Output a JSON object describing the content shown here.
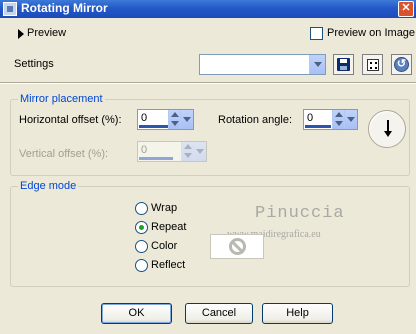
{
  "window": {
    "title": "Rotating Mirror"
  },
  "preview": {
    "label": "Preview",
    "on_image_label": "Preview on Image",
    "on_image_checked": false
  },
  "settings": {
    "label": "Settings",
    "preset_value": ""
  },
  "mirror_placement": {
    "legend": "Mirror placement",
    "horizontal_offset": {
      "label": "Horizontal offset (%):",
      "value": "0"
    },
    "vertical_offset": {
      "label": "Vertical offset (%):",
      "value": "0",
      "disabled": true
    },
    "rotation_angle": {
      "label": "Rotation angle:",
      "value": "0"
    }
  },
  "edge_mode": {
    "legend": "Edge mode",
    "options": [
      "Wrap",
      "Repeat",
      "Color",
      "Reflect"
    ],
    "selected": "Repeat",
    "color_swatch": "#ffffff"
  },
  "watermark": {
    "name": "Pinuccia",
    "url": "www.maidiregrafica.eu"
  },
  "buttons": {
    "ok": "OK",
    "cancel": "Cancel",
    "help": "Help"
  },
  "icons": [
    "app-icon",
    "close-icon",
    "save-icon",
    "dice-icon",
    "reset-icon",
    "rotation-dial-icon",
    "no-symbol-icon"
  ]
}
